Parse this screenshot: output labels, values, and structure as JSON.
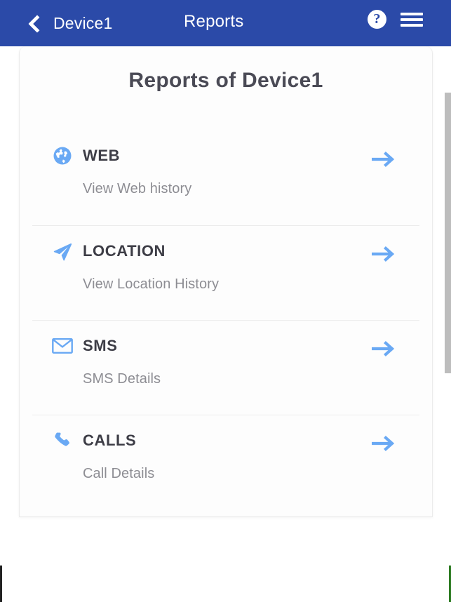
{
  "header": {
    "back_icon": "chevron-left-icon",
    "device_label": "Device1",
    "title": "Reports",
    "help_icon_label": "?",
    "help_icon": "help-circle-icon",
    "menu_icon": "hamburger-menu-icon",
    "background_color": "#2b4aa8"
  },
  "card": {
    "title": "Reports of Device1",
    "accent_color": "#6aa9f4",
    "label_color": "#3d3d46",
    "subtitle_color": "#8d8d93",
    "rows": [
      {
        "label": "WEB",
        "subtitle": "View Web history",
        "icon": "globe-icon",
        "arrow_icon": "arrow-right-icon"
      },
      {
        "label": "LOCATION",
        "subtitle": "View Location History",
        "icon": "navigation-arrow-icon",
        "arrow_icon": "arrow-right-icon"
      },
      {
        "label": "SMS",
        "subtitle": "SMS Details",
        "icon": "envelope-icon",
        "arrow_icon": "arrow-right-icon"
      },
      {
        "label": "CALLS",
        "subtitle": "Call Details",
        "icon": "phone-icon",
        "arrow_icon": "arrow-right-icon"
      }
    ]
  },
  "scrollbar": {
    "thumb_color": "#bdbdbd"
  }
}
